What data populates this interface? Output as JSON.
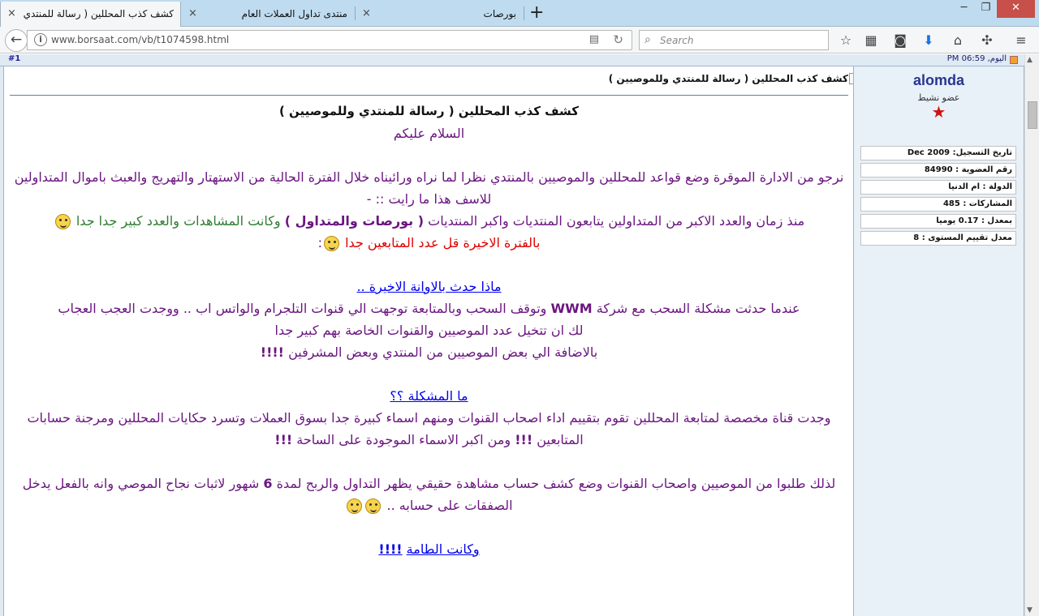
{
  "browser": {
    "tabs": [
      {
        "label": "كشف كذب المحللين ( رسالة للمنتدي وللموصيين",
        "close": "×",
        "active": true
      },
      {
        "label": "منتدى تداول العملات العام",
        "close": "×",
        "active": false
      },
      {
        "label": "بورصات",
        "close": "×",
        "active": false
      }
    ],
    "new_tab_label": "+",
    "url": "www.borsaat.com/vb/t1074598.html",
    "search_placeholder": "Search"
  },
  "post": {
    "number": "#1",
    "date": "اليوم, 06:59 PM",
    "title": "كشف كذب المحللين ( رسالة للمنتدي وللموصيين )"
  },
  "author": {
    "username": "alomda",
    "title": "عضو نشيط",
    "stats": [
      "تاريخ التسجيل: Dec 2009",
      "رقم العضوية : 84990",
      "الدولة : ام الدنيا",
      "المشاركات : 485",
      "بمعدل : 0.17 يوميا",
      "معدل تقييم المستوى : 8"
    ]
  },
  "message": {
    "heading": "كشف كذب المحللين ( رسالة للمنتدي وللموصيين )",
    "greeting": "السلام عليكم",
    "p1": "نرجو من الادارة الموقرة وضع قواعد للمحللين والموصيين بالمنتدي نظرا لما نراه ورائيناه خلال الفترة الحالية من الاستهتار والتهريج والعبث باموال المتداولين",
    "p1b": "للاسف هذا ما رايت :: -",
    "p2_a": "منذ زمان والعدد الاكبر من المتداولين يتابعون المنتديات واكبر المنتديات",
    "p2_b": "( بورصات والمتداول )",
    "p2_c": "وكانت المشاهدات والعدد كبير جدا جدا",
    "p3_a": "بالفترة الاخيرة قل عدد المتابعين جدا",
    "p3_b": ":",
    "sub1": "ماذا حدث بالاوانة الاخيرة ..",
    "p4_a": "عندما حدثت مشكلة السحب مع شركة",
    "p4_b": "WWM",
    "p4_c": "وتوقف السحب وبالمتابعة توجهت الي قنوات التلجرام والواتس اب .. ووجدت العجب العجاب",
    "p5": "لك ان تتخيل عدد الموصيين والقنوات الخاصة بهم كبير جدا",
    "p6_a": "بالاضافة الي بعض الموصيين من المنتدي وبعض المشرفين",
    "p6_b": "!!!!",
    "sub2": "ما المشكلة ؟؟",
    "p7_a": "وجدت قناة مخصصة لمتابعة المحللين تقوم بتقييم اداء اصحاب القنوات ومنهم اسماء كبيرة جدا بسوق العملات وتسرد حكايات المحللين ومرجنة حسابات المتابعين",
    "p7_b": "!!!",
    "p7_c": "ومن اكبر الاسماء الموجودة على الساحة",
    "p7_d": "!!!",
    "p8_a": "لذلك طلبوا من الموصيين واصحاب القنوات وضع كشف حساب مشاهدة حقيقي يظهر التداول والربح لمدة",
    "p8_b": "6",
    "p8_c": "شهور لاثبات نجاح الموصي وانه بالفعل يدخل الصفقات على حسابه ..",
    "sub3": "وكانت الطامة",
    "sub3_b": "!!!!"
  }
}
